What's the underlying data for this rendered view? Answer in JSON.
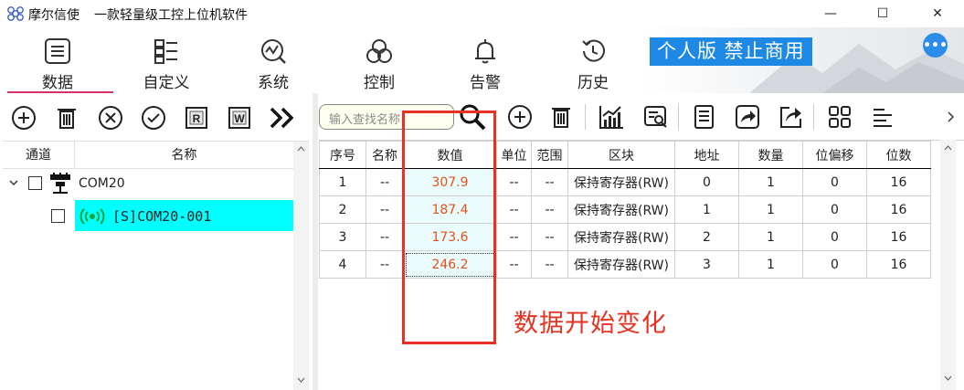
{
  "titlebar": {
    "app_name": "摩尔信使",
    "subtitle": "一款轻量级工控上位机软件",
    "minimize": "—",
    "maximize": "☐",
    "close": "✕"
  },
  "ribbon": {
    "tabs": [
      {
        "label": "数据",
        "icon": "data-icon",
        "active": true
      },
      {
        "label": "自定义",
        "icon": "custom-icon",
        "active": false
      },
      {
        "label": "系统",
        "icon": "system-icon",
        "active": false
      },
      {
        "label": "控制",
        "icon": "control-icon",
        "active": false
      },
      {
        "label": "告警",
        "icon": "bell-icon",
        "active": false
      },
      {
        "label": "历史",
        "icon": "history-icon",
        "active": false
      }
    ],
    "badge": "个人版  禁止商用",
    "more": "•••",
    "accent_color": "#d9306a",
    "badge_color": "#1e88e5"
  },
  "left_toolbar": [
    "add-icon",
    "delete-icon",
    "close-circle-icon",
    "check-circle-icon",
    "read-icon",
    "write-icon",
    "double-chevron-right-icon"
  ],
  "left_toolbar_text": {
    "read": "R",
    "write": "W"
  },
  "tree": {
    "headers": [
      "通道",
      "名称"
    ],
    "channel": {
      "label": "COM20",
      "checked": false,
      "expanded": true
    },
    "device": {
      "label": "[S]COM20-001",
      "checked": false,
      "selected": true,
      "selected_color": "#00ffff"
    }
  },
  "right_toolbar": {
    "search_placeholder": "输入查找名称",
    "icons": [
      "search-icon",
      "add-icon",
      "delete-icon",
      "chart-icon",
      "inspect-icon",
      "document-icon",
      "share-icon",
      "export-icon",
      "grid-icon",
      "align-icon"
    ]
  },
  "table": {
    "headers": [
      "序号",
      "名称",
      "数值",
      "单位",
      "范围",
      "区块",
      "地址",
      "数量",
      "位偏移",
      "位数"
    ],
    "rows": [
      [
        "1",
        "--",
        "307.9",
        "--",
        "--",
        "保持寄存器(RW)",
        "0",
        "1",
        "0",
        "16"
      ],
      [
        "2",
        "--",
        "187.4",
        "--",
        "--",
        "保持寄存器(RW)",
        "1",
        "1",
        "0",
        "16"
      ],
      [
        "3",
        "--",
        "173.6",
        "--",
        "--",
        "保持寄存器(RW)",
        "2",
        "1",
        "0",
        "16"
      ],
      [
        "4",
        "--",
        "246.2",
        "--",
        "--",
        "保持寄存器(RW)",
        "3",
        "1",
        "0",
        "16"
      ]
    ],
    "value_color": "#e2521b"
  },
  "annotation": {
    "text": "数据开始变化",
    "color": "#e53222"
  }
}
